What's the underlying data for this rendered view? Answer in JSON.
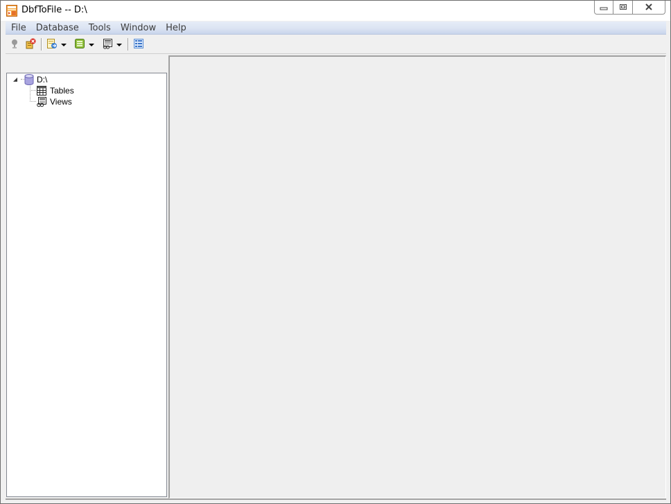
{
  "window": {
    "title": "DbfToFile -- D:\\",
    "app_icon": "dbf-app-icon"
  },
  "caption_buttons": {
    "minimize": "minimize-icon",
    "restore": "restore-icon",
    "close": "close-icon"
  },
  "menu": {
    "items": [
      {
        "label": "File"
      },
      {
        "label": "Database"
      },
      {
        "label": "Tools"
      },
      {
        "label": "Window"
      },
      {
        "label": "Help"
      }
    ]
  },
  "toolbar": {
    "buttons": [
      {
        "icon": "connect-icon",
        "enabled": false
      },
      {
        "icon": "disconnect-icon",
        "enabled": true
      },
      {
        "icon": "export-icon",
        "enabled": true,
        "dropdown": true
      },
      {
        "icon": "table-export-icon",
        "enabled": true,
        "dropdown": true
      },
      {
        "icon": "view-export-icon",
        "enabled": true,
        "dropdown": true
      },
      {
        "icon": "list-view-icon",
        "enabled": true
      }
    ]
  },
  "tree": {
    "root": {
      "label": "D:\\",
      "icon": "database-icon",
      "expanded": true
    },
    "children": [
      {
        "label": "Tables",
        "icon": "tables-icon"
      },
      {
        "label": "Views",
        "icon": "views-icon"
      }
    ]
  },
  "colors": {
    "menubar_top": "#e6ecf7",
    "menubar_bottom": "#c9d5ec",
    "client_area": "#efefef"
  }
}
